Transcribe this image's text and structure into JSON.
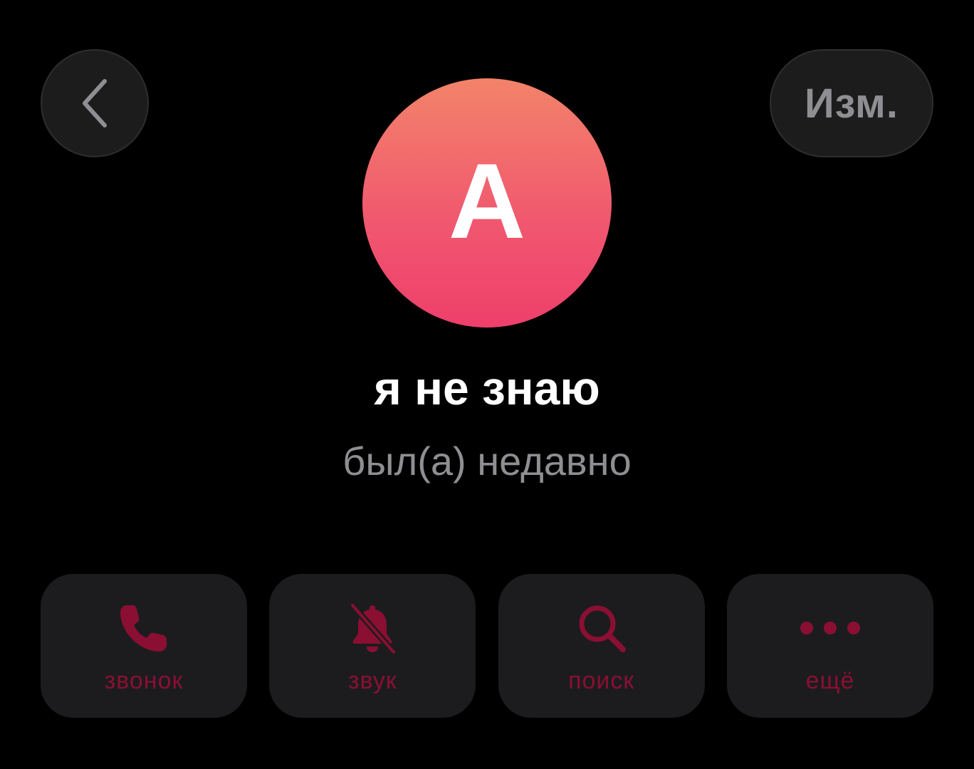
{
  "header": {
    "back_icon": "chevron-left-icon",
    "edit_label": "Изм."
  },
  "profile": {
    "avatar_letter": "A",
    "name": "я не знаю",
    "status": "был(а) недавно"
  },
  "actions": [
    {
      "label": "звонок",
      "icon": "phone-icon"
    },
    {
      "label": "звук",
      "icon": "bell-slash-icon"
    },
    {
      "label": "поиск",
      "icon": "search-icon"
    },
    {
      "label": "ещё",
      "icon": "more-icon"
    }
  ],
  "colors": {
    "background": "#000000",
    "button_bg": "#1c1c1e",
    "accent": "#8a0f33",
    "secondary_text": "#8e8e93",
    "avatar_top": "#f3836a",
    "avatar_bottom": "#ee3f6b"
  }
}
